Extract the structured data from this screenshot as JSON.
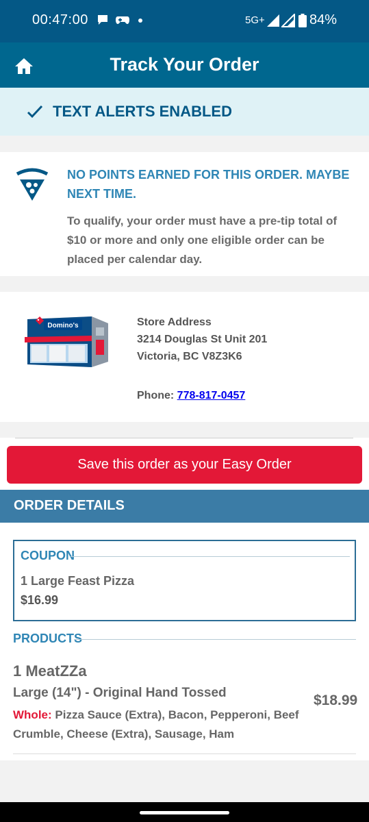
{
  "status_bar": {
    "time": "00:47:00",
    "network": "5G+",
    "battery": "84%",
    "icons": [
      "chat-notification-icon",
      "game-controller-icon",
      "dot-icon",
      "signal-icon",
      "signal-icon",
      "battery-icon"
    ]
  },
  "header": {
    "title": "Track Your Order",
    "home_icon": "home-icon"
  },
  "alert": {
    "text": "TEXT ALERTS ENABLED",
    "icon": "check-icon"
  },
  "points": {
    "title": "NO POINTS EARNED FOR THIS ORDER. MAYBE NEXT TIME.",
    "description": "To qualify, your order must have a pre-tip total of $10 or more and only one eligible order can be placed per calendar day.",
    "icon": "rewards-pizza-icon"
  },
  "store": {
    "address_label": "Store Address",
    "address_line1": "3214 Douglas St Unit 201",
    "address_line2": "Victoria, BC V8Z3K6",
    "phone_label": "Phone:",
    "phone": "778-817-0457",
    "sign_text": "Domino's"
  },
  "easy_order_button": "Save this order as your Easy Order",
  "order_details": {
    "heading": "ORDER DETAILS",
    "coupon": {
      "label": "COUPON",
      "name": "1 Large Feast Pizza",
      "price": "$16.99"
    },
    "products_label": "PRODUCTS",
    "product": {
      "name": "1 MeatZZa",
      "size": "Large (14\") - Original Hand Tossed",
      "whole_label": "Whole:",
      "toppings": "Pizza Sauce (Extra), Bacon, Pepperoni, Beef Crumble, Cheese (Extra), Sausage, Ham",
      "price": "$18.99"
    }
  },
  "colors": {
    "status_bar": "#045886",
    "header": "#00678f",
    "alert_bg": "#dff2f6",
    "accent_blue": "#2f86b5",
    "order_bar": "#3b7ca6",
    "button_red": "#e31837"
  }
}
